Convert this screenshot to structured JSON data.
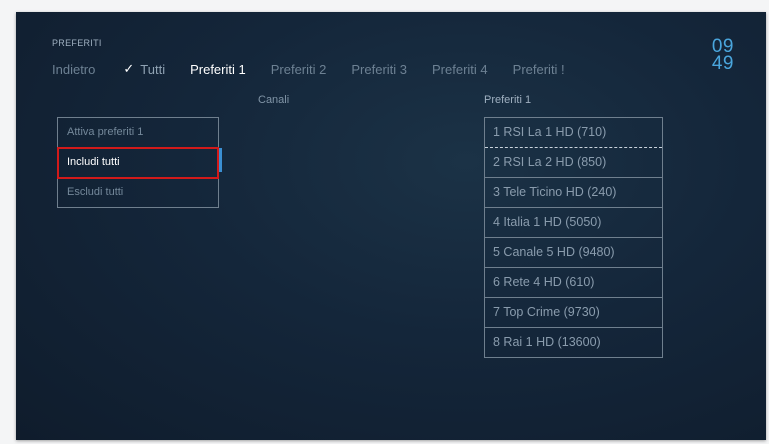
{
  "header": {
    "breadcrumb": "PREFERITI",
    "tabs": [
      {
        "label": "Indietro"
      },
      {
        "label": "Tutti",
        "checked": true
      },
      {
        "label": "Preferiti 1",
        "active": true
      },
      {
        "label": "Preferiti 2"
      },
      {
        "label": "Preferiti 3"
      },
      {
        "label": "Preferiti 4"
      },
      {
        "label": "Preferiti !"
      }
    ],
    "clock": {
      "hours": "09",
      "minutes": "49"
    }
  },
  "columns": {
    "left_title": "Canali",
    "right_title": "Preferiti 1"
  },
  "menu": {
    "items": [
      {
        "label": "Attiva preferiti 1"
      },
      {
        "label": "Includi tutti",
        "selected": true
      },
      {
        "label": "Escludi tutti"
      }
    ]
  },
  "channels": [
    "1 RSI La 1 HD (710)",
    "2 RSI La 2 HD (850)",
    "3 Tele Ticino HD (240)",
    "4 Italia 1 HD (5050)",
    "5 Canale 5 HD (9480)",
    "6 Rete 4 HD (610)",
    "7 Top Crime (9730)",
    "8 Rai 1 HD (13600)"
  ],
  "colors": {
    "accent": "#4aa6dd",
    "selection_outline": "#d21a1a",
    "background": "#14263a"
  }
}
